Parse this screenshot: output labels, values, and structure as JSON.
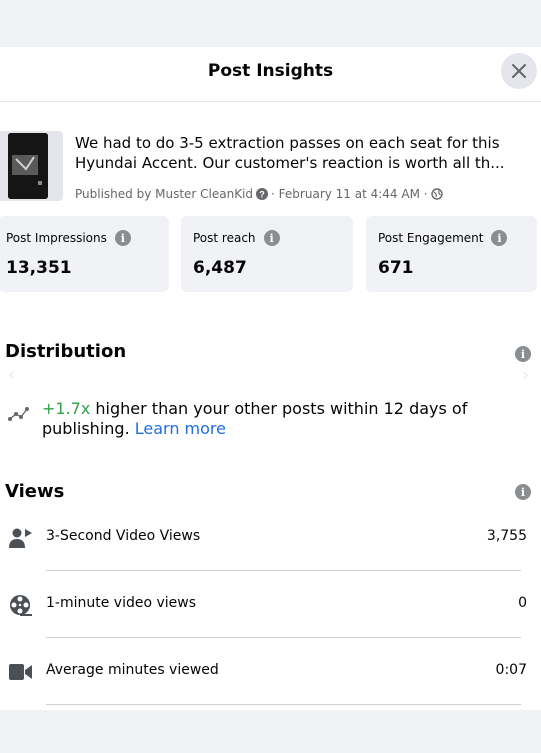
{
  "dialog": {
    "title": "Post Insights"
  },
  "post": {
    "text_line1": "We had to do 3-5 extraction passes on each seat for this",
    "text_line2": "Hyundai Accent. Our customer's reaction is worth all th...",
    "meta": "Published by Muster CleanKid",
    "date": "· February 11 at 4:44 AM ·"
  },
  "metrics": [
    {
      "label": "Post Impressions",
      "value": "13,351"
    },
    {
      "label": "Post reach",
      "value": "6,487"
    },
    {
      "label": "Post Engagement",
      "value": "671"
    }
  ],
  "distribution": {
    "title": "Distribution",
    "multiplier": "+1.7x",
    "text": " higher than your other posts within 12 days of publishing. ",
    "link": "Learn more"
  },
  "views": {
    "title": "Views",
    "rows": [
      {
        "icon": "person-video-icon",
        "label": "3-Second Video Views",
        "value": "3,755"
      },
      {
        "icon": "film-reel-icon",
        "label": "1-minute video views",
        "value": "0"
      },
      {
        "icon": "video-camera-icon",
        "label": "Average minutes viewed",
        "value": "0:07"
      }
    ]
  }
}
